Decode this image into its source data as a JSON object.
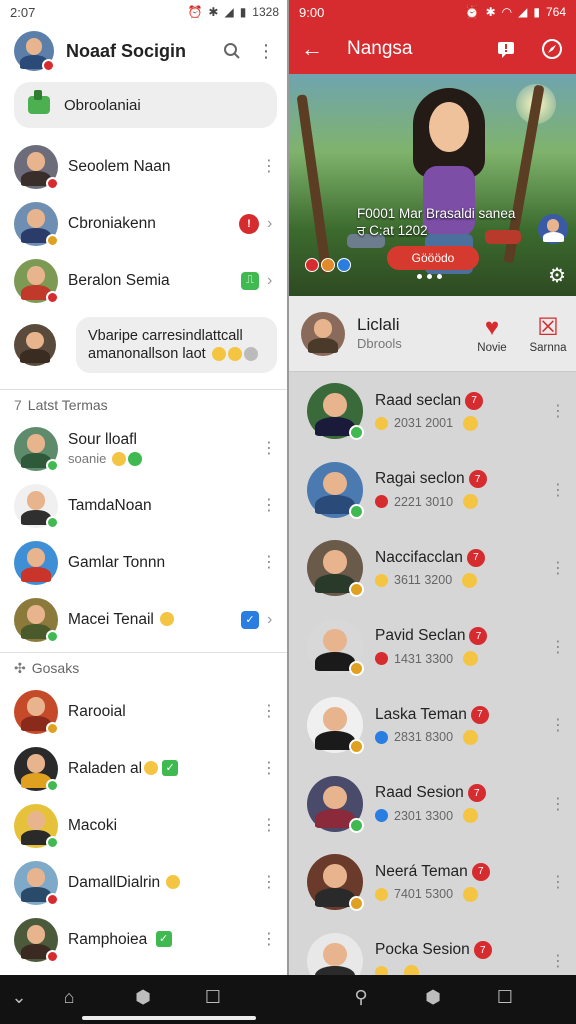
{
  "left": {
    "status": {
      "time": "2:07",
      "battery": "1328"
    },
    "header": {
      "title": "Noaaf Socigin"
    },
    "pill": {
      "label": "Obroolaniai"
    },
    "rows": [
      {
        "name": "Seoolem Naan",
        "end": "dots"
      },
      {
        "name": "Cbroniakenn",
        "end": "chev",
        "badge": "!"
      },
      {
        "name": "Beralon Semia",
        "end": "chev",
        "badge": "⎍"
      }
    ],
    "bubble": {
      "line1": "Vbaripe carresindlattcall",
      "line2": "amanonallson laot"
    },
    "section1": {
      "label": "Latst Termas",
      "icon": "7"
    },
    "rows2": [
      {
        "name": "Sour lloafl",
        "sub": "soanie"
      },
      {
        "name": "TamdaNoan"
      },
      {
        "name": "Gamlar Tonnn"
      },
      {
        "name": "Macei Tenail"
      }
    ],
    "section2": {
      "label": "Gosaks"
    },
    "rows3": [
      {
        "name": "Rarooial"
      },
      {
        "name": "Raladen al"
      },
      {
        "name": "Macoki"
      },
      {
        "name": "DamallDialrin"
      },
      {
        "name": "Ramphoiea"
      }
    ]
  },
  "right": {
    "status": {
      "time": "9:00",
      "battery": "764"
    },
    "header": {
      "title": "Nangsa"
    },
    "hero": {
      "caption1": "F0001 Mar Brasaldi sanea",
      "caption2": "ਰ C:at 1202",
      "cta": "Gööödo"
    },
    "profile": {
      "name": "Liclali",
      "sub": "Dbrools",
      "action1": "Novie",
      "action2": "Sarnna"
    },
    "rows": [
      {
        "name": "Raad seclan",
        "sub": "2031 2001"
      },
      {
        "name": "Ragai seclon",
        "sub": "2221 3010"
      },
      {
        "name": "Naccifacclan",
        "sub": "3611 3200"
      },
      {
        "name": "Pavid Seclan",
        "sub": "1431 3300"
      },
      {
        "name": "Laska Teman",
        "sub": "2831 8300"
      },
      {
        "name": "Raad Sesion",
        "sub": "2301 3300"
      },
      {
        "name": "Neerá Teman",
        "sub": "7401 5300"
      },
      {
        "name": "Pocka Sesion",
        "sub": ""
      }
    ]
  },
  "colors": {
    "accent": "#d62b2f",
    "green": "#3fb950",
    "blue": "#2a7de1"
  }
}
